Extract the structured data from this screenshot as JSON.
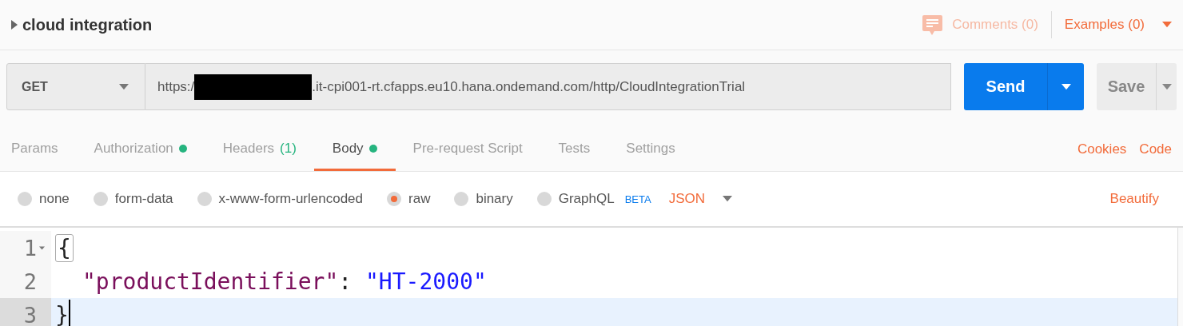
{
  "request_name": {
    "title": "cloud integration",
    "collapsed": true
  },
  "header_links": {
    "comments": "Comments (0)",
    "examples": "Examples (0)"
  },
  "request_bar": {
    "method": "GET",
    "url_prefix": "https:/",
    "url_redacted": true,
    "url_suffix": ".it-cpi001-rt.cfapps.eu10.hana.ondemand.com/http/CloudIntegrationTrial",
    "send": "Send",
    "save": "Save"
  },
  "tabs": [
    {
      "label": "Params",
      "dot": false,
      "selected": false
    },
    {
      "label": "Authorization",
      "dot": true,
      "selected": false
    },
    {
      "label": "Headers",
      "count": "(1)",
      "dot": false,
      "selected": false
    },
    {
      "label": "Body",
      "dot": true,
      "selected": true
    },
    {
      "label": "Pre-request Script",
      "dot": false,
      "selected": false
    },
    {
      "label": "Tests",
      "dot": false,
      "selected": false
    },
    {
      "label": "Settings",
      "dot": false,
      "selected": false
    }
  ],
  "tab_links": [
    "Cookies",
    "Code"
  ],
  "body_types": [
    {
      "label": "none",
      "selected": false
    },
    {
      "label": "form-data",
      "selected": false
    },
    {
      "label": "x-www-form-urlencoded",
      "selected": false
    },
    {
      "label": "raw",
      "selected": true
    },
    {
      "label": "binary",
      "selected": false
    },
    {
      "label": "GraphQL",
      "badge": "BETA",
      "selected": false
    }
  ],
  "format": "JSON",
  "beautify": "Beautify",
  "editor_lines": [
    {
      "number": "1",
      "foldable": true,
      "current": false,
      "tokens": [
        {
          "kind": "punct",
          "text": "{",
          "matched": true
        }
      ]
    },
    {
      "number": "2",
      "foldable": false,
      "current": false,
      "indented": true,
      "tokens": [
        {
          "kind": "key",
          "text": "\"productIdentifier\"",
          "matched": false
        },
        {
          "kind": "punct",
          "text": ": ",
          "matched": false
        },
        {
          "kind": "string",
          "text": "\"HT-2000\"",
          "matched": false
        }
      ]
    },
    {
      "number": "3",
      "foldable": false,
      "current": true,
      "tokens": [
        {
          "kind": "punct",
          "text": "}",
          "matched": false
        }
      ]
    }
  ]
}
